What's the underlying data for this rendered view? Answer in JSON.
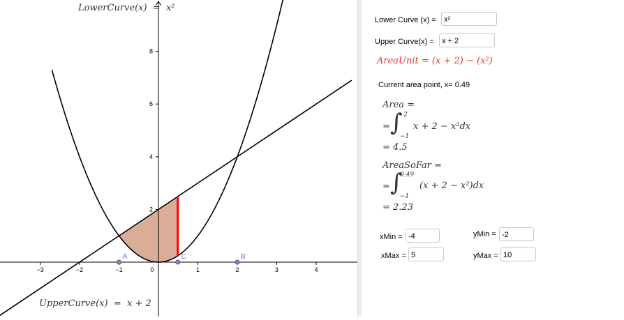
{
  "graph": {
    "lower_curve_label": "LowerCurve(x)",
    "lower_curve_expr": "x²",
    "upper_curve_label": "UpperCurve(x)",
    "upper_curve_expr": "x + 2",
    "x_ticks": [
      "−3",
      "−2",
      "−1",
      "0",
      "1",
      "2",
      "3",
      "4"
    ],
    "y_ticks": [
      "2",
      "4",
      "6",
      "8"
    ],
    "points": [
      {
        "label": "A",
        "x": -1,
        "y": 0
      },
      {
        "label": "B",
        "x": 2,
        "y": 0
      },
      {
        "label": "C",
        "x": 0.49,
        "y": 0
      }
    ],
    "current_x": 0.49,
    "colors": {
      "fill": "#d9ad98",
      "segment": "#ff0000",
      "point": "#6b6bd6",
      "curve": "#000000"
    }
  },
  "algebra": {
    "lower_curve": {
      "label": "Lower Curve (x) =",
      "value": "x²"
    },
    "upper_curve": {
      "label": "Upper Curve(x) =",
      "value": "x + 2"
    },
    "area_unit": "AreaUnit = (x + 2) − (x²)",
    "current_point": "Current area point, x= 0.49",
    "area": {
      "name": "Area =",
      "eq": "=",
      "upper": "2",
      "lower": "−1",
      "integrand": "x + 2 − x²dx",
      "result": "= 4.5"
    },
    "area_so_far": {
      "name": "AreaSoFar =",
      "eq": "=",
      "upper": "0.49",
      "lower": "−1",
      "integrand": "(x + 2 − x²)dx",
      "result": "= 2.23"
    },
    "xmin": {
      "label": "xMin =",
      "value": "-4"
    },
    "xmax": {
      "label": "xMax =",
      "value": "5"
    },
    "ymin": {
      "label": "yMin =",
      "value": "-2"
    },
    "ymax": {
      "label": "yMax =",
      "value": "10"
    }
  }
}
